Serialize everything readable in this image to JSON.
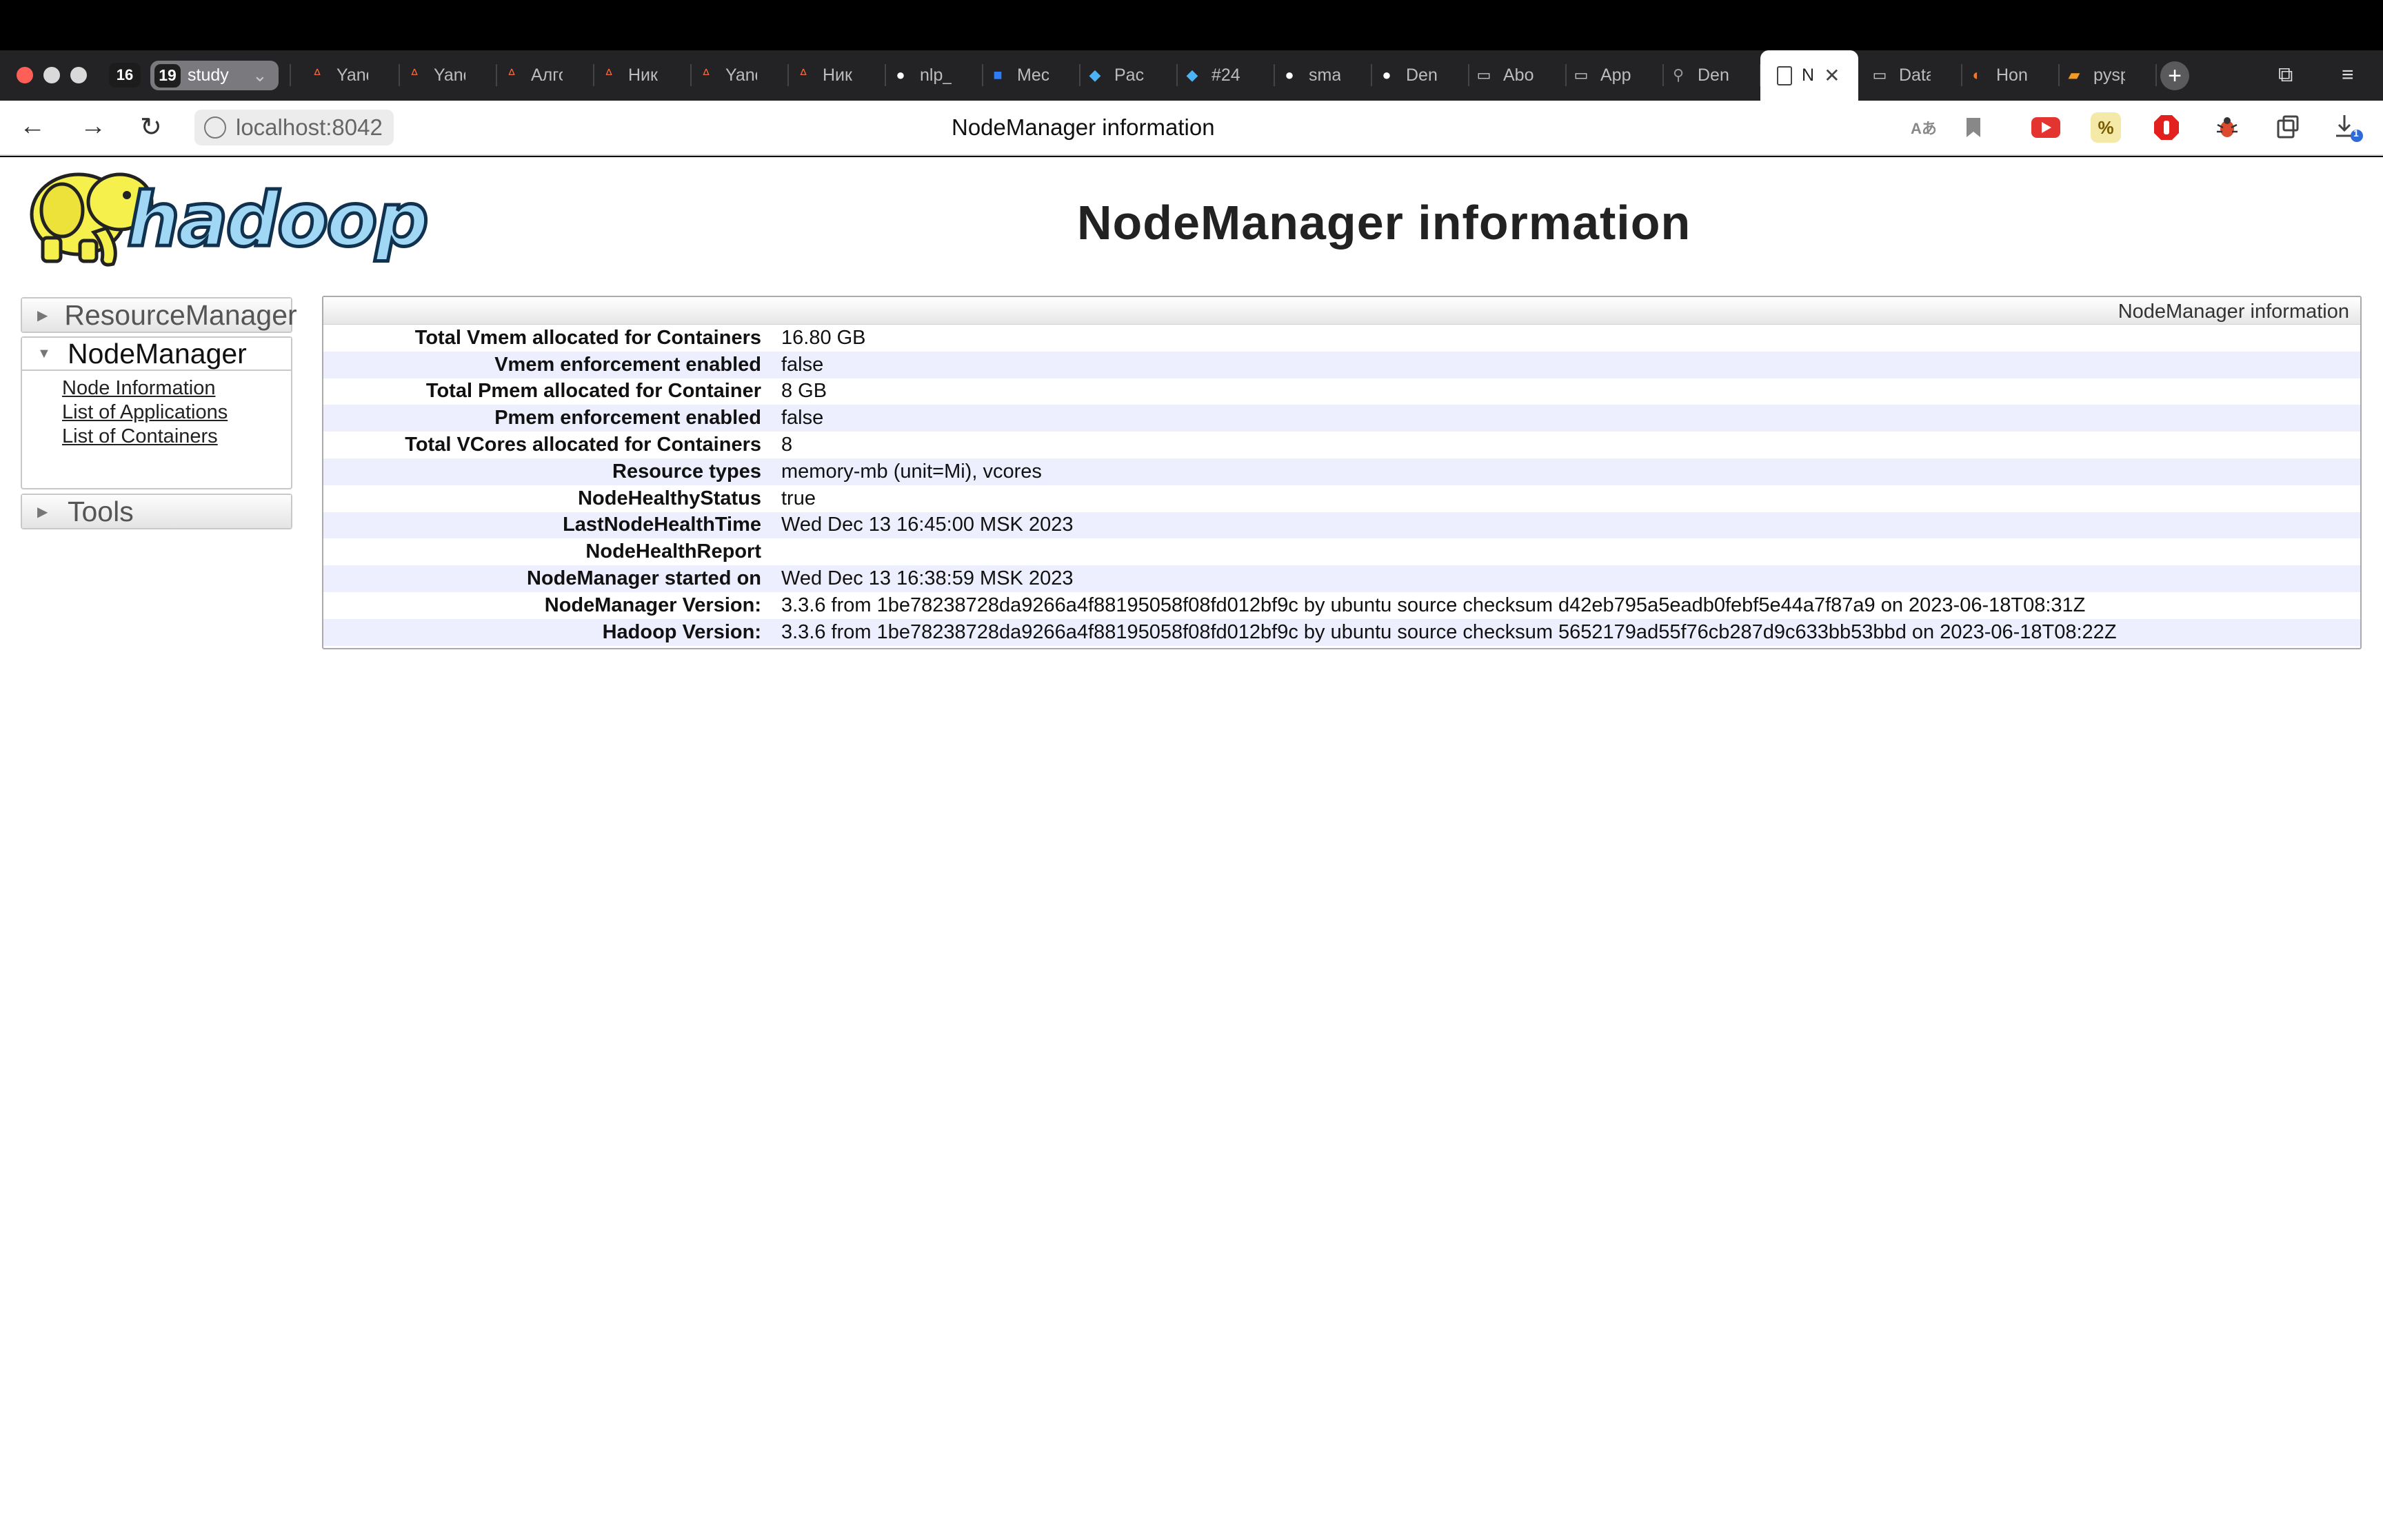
{
  "browser": {
    "tab_group": {
      "count_badge": "16",
      "group_count": "19",
      "group_label": "study"
    },
    "tabs": [
      {
        "title": "Yandex",
        "icon": "yandex-icon",
        "color": "#ff6a3d"
      },
      {
        "title": "Yandex",
        "icon": "yandex-icon",
        "color": "#ff6a3d"
      },
      {
        "title": "Алгоритмы",
        "icon": "yandex-icon",
        "color": "#ff6a3d"
      },
      {
        "title": "Ник",
        "icon": "yandex-icon",
        "color": "#ff6a3d"
      },
      {
        "title": "Yandex",
        "icon": "yandex-icon",
        "color": "#ff6a3d"
      },
      {
        "title": "Ник",
        "icon": "yandex-icon",
        "color": "#ff6a3d"
      },
      {
        "title": "nlp_",
        "icon": "github-icon",
        "color": "#ffffff"
      },
      {
        "title": "Mec",
        "icon": "chat-icon",
        "color": "#2f7cf6"
      },
      {
        "title": "Pac",
        "icon": "app-icon",
        "color": "#4cb3f5"
      },
      {
        "title": "#24",
        "icon": "app-icon",
        "color": "#4cb3f5"
      },
      {
        "title": "sma",
        "icon": "github-icon",
        "color": "#ffffff"
      },
      {
        "title": "Den",
        "icon": "github-icon",
        "color": "#ffffff"
      },
      {
        "title": "Abo",
        "icon": "document-icon",
        "color": "#cccccc"
      },
      {
        "title": "App",
        "icon": "document-icon",
        "color": "#cccccc"
      },
      {
        "title": "Den",
        "icon": "scooter-icon",
        "color": "#999999"
      }
    ],
    "active_tab": {
      "title": "N",
      "icon": "document-icon"
    },
    "tabs_after": [
      {
        "title": "Data",
        "icon": "document-icon",
        "color": "#cccccc"
      },
      {
        "title": "Hon",
        "icon": "jupyter-icon",
        "color": "#f37626"
      },
      {
        "title": "pysp",
        "icon": "book-icon",
        "color": "#f59a23"
      }
    ],
    "url": "localhost:8042",
    "page_title": "NodeManager information",
    "download_badge": "1"
  },
  "page": {
    "logo_text": "hadoop",
    "heading": "NodeManager information",
    "nav": {
      "resourcemanager": "ResourceManager",
      "nodemanager": "NodeManager",
      "links": [
        "Node Information",
        "List of Applications",
        "List of Containers"
      ],
      "tools": "Tools"
    },
    "info": {
      "caption": "NodeManager information",
      "rows": [
        {
          "key": "Total Vmem allocated for Containers",
          "value": "16.80 GB"
        },
        {
          "key": "Vmem enforcement enabled",
          "value": "false"
        },
        {
          "key": "Total Pmem allocated for Container",
          "value": "8 GB"
        },
        {
          "key": "Pmem enforcement enabled",
          "value": "false"
        },
        {
          "key": "Total VCores allocated for Containers",
          "value": "8"
        },
        {
          "key": "Resource types",
          "value": "memory-mb (unit=Mi), vcores"
        },
        {
          "key": "NodeHealthyStatus",
          "value": "true"
        },
        {
          "key": "LastNodeHealthTime",
          "value": "Wed Dec 13 16:45:00 MSK 2023"
        },
        {
          "key": "NodeHealthReport",
          "value": ""
        },
        {
          "key": "NodeManager started on",
          "value": "Wed Dec 13 16:38:59 MSK 2023"
        },
        {
          "key": "NodeManager Version:",
          "value": "3.3.6 from 1be78238728da9266a4f88195058f08fd012bf9c by ubuntu source checksum d42eb795a5eadb0febf5e44a7f87a9 on 2023-06-18T08:31Z"
        },
        {
          "key": "Hadoop Version:",
          "value": "3.3.6 from 1be78238728da9266a4f88195058f08fd012bf9c by ubuntu source checksum 5652179ad55f76cb287d9c633bb53bbd on 2023-06-18T08:22Z"
        }
      ]
    }
  }
}
